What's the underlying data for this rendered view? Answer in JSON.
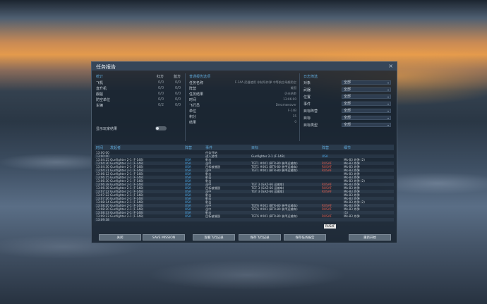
{
  "window": {
    "title": "任务报告",
    "close": "×"
  },
  "stats": {
    "header": "统计",
    "col1": "红方",
    "col2": "蓝方",
    "rows": [
      {
        "label": "飞机",
        "a": "0/0",
        "b": "0/0"
      },
      {
        "label": "直升机",
        "a": "0/0",
        "b": "0/0"
      },
      {
        "label": "舰船",
        "a": "0/0",
        "b": "0/0"
      },
      {
        "label": "防空单位",
        "a": "0/0",
        "b": "0/0"
      },
      {
        "label": "车辆",
        "a": "0/2",
        "b": "0/0"
      }
    ],
    "show_player_label": "显示玩家结果"
  },
  "summary": {
    "header": "普通报告选项",
    "rows": [
      {
        "label": "任务名称",
        "value": "F-14A 武器使用 非制导炸弹 中等航空母舰防空"
      },
      {
        "label": "阵营",
        "value": "美国"
      },
      {
        "label": "任务结果",
        "value": "仍未结束"
      },
      {
        "label": "时间",
        "value": "13:06:00"
      },
      {
        "label": "飞行员",
        "value": "Dreamweaver"
      },
      {
        "label": "单位",
        "value": "F-14B"
      },
      {
        "label": "积分",
        "value": "15"
      },
      {
        "label": "结果",
        "value": "0"
      }
    ]
  },
  "filters": {
    "header": "日志筛选",
    "rows": [
      {
        "label": "对象",
        "value": "全部"
      },
      {
        "label": "武器",
        "value": "全部"
      },
      {
        "label": "位置",
        "value": "全部"
      },
      {
        "label": "事件",
        "value": "全部"
      },
      {
        "label": "目标阵营",
        "value": "全部"
      },
      {
        "label": "目标",
        "value": "全部"
      },
      {
        "label": "目标类型",
        "value": "全部"
      }
    ]
  },
  "log": {
    "columns": [
      "时间",
      "发起者",
      "阵营",
      "事件",
      "目标",
      "阵营",
      "细节"
    ],
    "rows": [
      {
        "time": "13:00:00",
        "initiator": "",
        "side": "",
        "event": "任务开始",
        "target": "",
        "tside": "",
        "detail": ""
      },
      {
        "time": "13:00:00",
        "initiator": "",
        "side": "",
        "event": "进入游戏",
        "target": "Gunfighter 2-1 (F-14B)",
        "tside": "USA",
        "detail": ""
      },
      {
        "time": "13:04:25",
        "initiator": "Gunfighter 2-1 (F-14B)",
        "side": "USA",
        "event": "射击",
        "target": "",
        "tside": "",
        "detail": "Mk-83 炸弹 (2)"
      },
      {
        "time": "13:04:30",
        "initiator": "Gunfighter 2-1 (F-14B)",
        "side": "USA",
        "event": "击中",
        "target": "TGT1 #001 (BTR-80 装甲运输车)",
        "tside": "RUSAF",
        "detail": "Mk-83 炸弹"
      },
      {
        "time": "13:04:30",
        "initiator": "Gunfighter 2-1 (F-14B)",
        "side": "USA",
        "event": "目标被摧毁",
        "target": "TGT1 #001 (BTR-80 装甲运输车)",
        "tside": "RUSAF",
        "detail": "Mk-83 炸弹"
      },
      {
        "time": "13:04:31",
        "initiator": "Gunfighter 2-1 (F-14B)",
        "side": "USA",
        "event": "击中",
        "target": "TGT1 #001 (BTR-80 装甲运输车)",
        "tside": "RUSAF",
        "detail": "Mk-83 炸弹"
      },
      {
        "time": "13:06:12",
        "initiator": "Gunfighter 2-1 (F-14B)",
        "side": "USA",
        "event": "射击",
        "target": "",
        "tside": "",
        "detail": "Mk-83 炸弹"
      },
      {
        "time": "13:06:15",
        "initiator": "Gunfighter 2-1 (F-14B)",
        "side": "USA",
        "event": "射击",
        "target": "",
        "tside": "",
        "detail": "Mk-83 炸弹"
      },
      {
        "time": "13:06:30",
        "initiator": "Gunfighter 2-1 (F-14B)",
        "side": "USA",
        "event": "射击",
        "target": "",
        "tside": "",
        "detail": "Mk-83 炸弹 (2)"
      },
      {
        "time": "13:06:38",
        "initiator": "Gunfighter 2-1 (F-14B)",
        "side": "USA",
        "event": "击中",
        "target": "TGT 3 (GAZ-66 运输车)",
        "tside": "RUSAF",
        "detail": "Mk-83 炸弹"
      },
      {
        "time": "13:06:38",
        "initiator": "Gunfighter 2-1 (F-14B)",
        "side": "USA",
        "event": "目标被摧毁",
        "target": "TGT 3 (GAZ-66 运输车)",
        "tside": "RUSAF",
        "detail": "Mk-83 炸弹"
      },
      {
        "time": "13:07:22",
        "initiator": "Gunfighter 2-1 (F-14B)",
        "side": "USA",
        "event": "击中",
        "target": "TGT 3 (GAZ-66 运输车)",
        "tside": "RUSAF",
        "detail": "Mk-83 炸弹"
      },
      {
        "time": "13:07:22",
        "initiator": "Gunfighter 2-1 (F-14B)",
        "side": "USA",
        "event": "射击",
        "target": "",
        "tside": "",
        "detail": "Mk-83 炸弹"
      },
      {
        "time": "13:07:26",
        "initiator": "Gunfighter 2-1 (F-14B)",
        "side": "USA",
        "event": "射击",
        "target": "",
        "tside": "",
        "detail": "Mk-83 炸弹"
      },
      {
        "time": "13:08:14",
        "initiator": "Gunfighter 2-1 (F-14B)",
        "side": "USA",
        "event": "射击",
        "target": "",
        "tside": "",
        "detail": "Mk-83 炸弹 (2)"
      },
      {
        "time": "13:08:20",
        "initiator": "Gunfighter 2-1 (F-14B)",
        "side": "USA",
        "event": "击中",
        "target": "TGT6 #001 (BTR-80 装甲运输车)",
        "tside": "RUSAF",
        "detail": "Mk-83 炸弹"
      },
      {
        "time": "13:08:20",
        "initiator": "Gunfighter 2-1 (F-14B)",
        "side": "USA",
        "event": "击中",
        "target": "TGT6 #001 (BTR-80 装甲运输车)",
        "tside": "RUSAF",
        "detail": "Mk-83 炸弹"
      },
      {
        "time": "13:08:33",
        "initiator": "Gunfighter 2-1 (F-14B)",
        "side": "USA",
        "event": "射击",
        "target": "",
        "tside": "",
        "detail": "(1)"
      },
      {
        "time": "13:09:23",
        "initiator": "Gunfighter 2-1 (F-14B)",
        "side": "USA",
        "event": "目标被摧毁",
        "target": "TGT6 #001 (BTR-80 装甲运输车)",
        "tside": "RUSAF",
        "detail": "Mk-83 炸弹"
      },
      {
        "time": "13:09:38",
        "initiator": "",
        "side": "",
        "event": "",
        "target": "",
        "tside": "",
        "detail": ""
      }
    ]
  },
  "badge": "RUSAF",
  "buttons": [
    {
      "name": "close-button",
      "label": "关闭"
    },
    {
      "name": "save-mission-button",
      "label": "SAVE MISSION"
    },
    {
      "name": "view-track-button",
      "label": "观看飞行记录"
    },
    {
      "name": "save-track-button",
      "label": "保存飞行记录"
    },
    {
      "name": "save-report-button",
      "label": "保存任务报告"
    },
    {
      "name": "restart-button",
      "label": "重新开始"
    }
  ],
  "colors": {
    "accent": "#5fa8d8",
    "enemy": "#e05a4a",
    "friendly": "#4aa8e8"
  }
}
